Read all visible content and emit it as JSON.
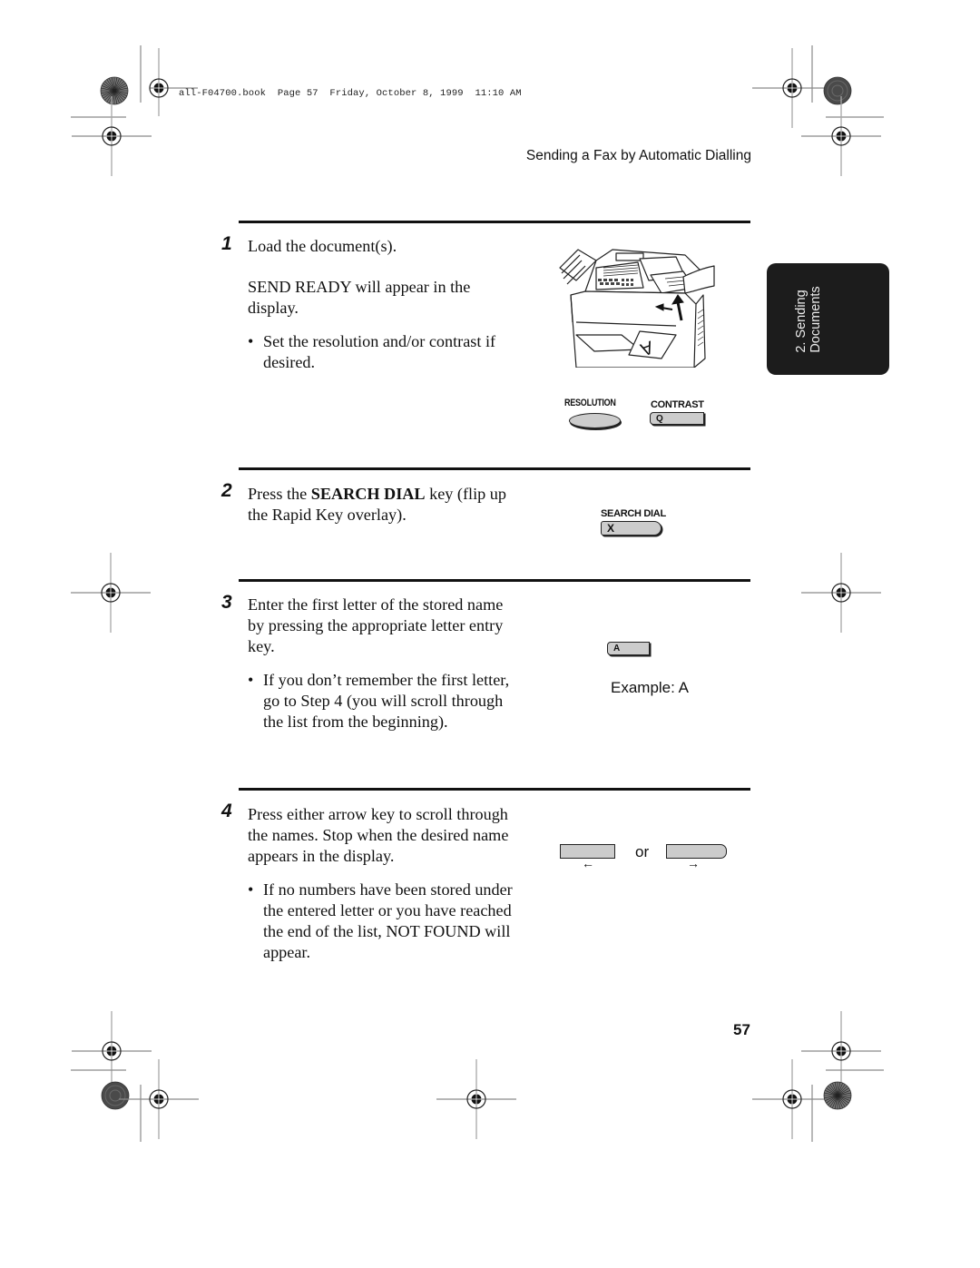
{
  "print_header": "all-F04700.book  Page 57  Friday, October 8, 1999  11:10 AM",
  "running_head": "Sending a Fax by Automatic Dialling",
  "side_tab": {
    "line1": "2. Sending",
    "line2": "Documents",
    "background": "#1c1c1c"
  },
  "steps": [
    {
      "number": "1",
      "text": "Load the document(s).",
      "paragraphs": [
        "SEND READY will appear in the display."
      ],
      "bullets": [
        "Set the resolution and/or contrast if desired."
      ],
      "illustration": {
        "icon": "fax-machine-loading-document-icon",
        "document_letter": "A"
      },
      "keys": [
        {
          "label": "RESOLUTION",
          "cap": ""
        },
        {
          "label": "CONTRAST",
          "cap": "Q"
        }
      ]
    },
    {
      "number": "2",
      "text_prefix": "Press the ",
      "text_bold": "SEARCH DIAL",
      "text_suffix": " key (flip up the Rapid Key overlay).",
      "keys": [
        {
          "label": "SEARCH DIAL",
          "cap": "X"
        }
      ]
    },
    {
      "number": "3",
      "text": "Enter the first letter of the stored name by pressing the appropriate letter entry key.",
      "bullets": [
        "If you don’t remember the first letter, go to Step 4 (you will scroll through the list from the beginning)."
      ],
      "keys": [
        {
          "label": "",
          "cap": "A"
        }
      ],
      "example": "Example: A"
    },
    {
      "number": "4",
      "text": "Press either arrow key to scroll through the names. Stop when the desired name appears in the display.",
      "bullets": [
        "If no numbers have been stored under the entered letter or you have reached the end of the list, NOT FOUND will appear."
      ],
      "keys": [
        {
          "label": "←",
          "cap": ""
        },
        {
          "label": "→",
          "cap": ""
        }
      ],
      "or_label": "or"
    }
  ],
  "page_number": "57"
}
